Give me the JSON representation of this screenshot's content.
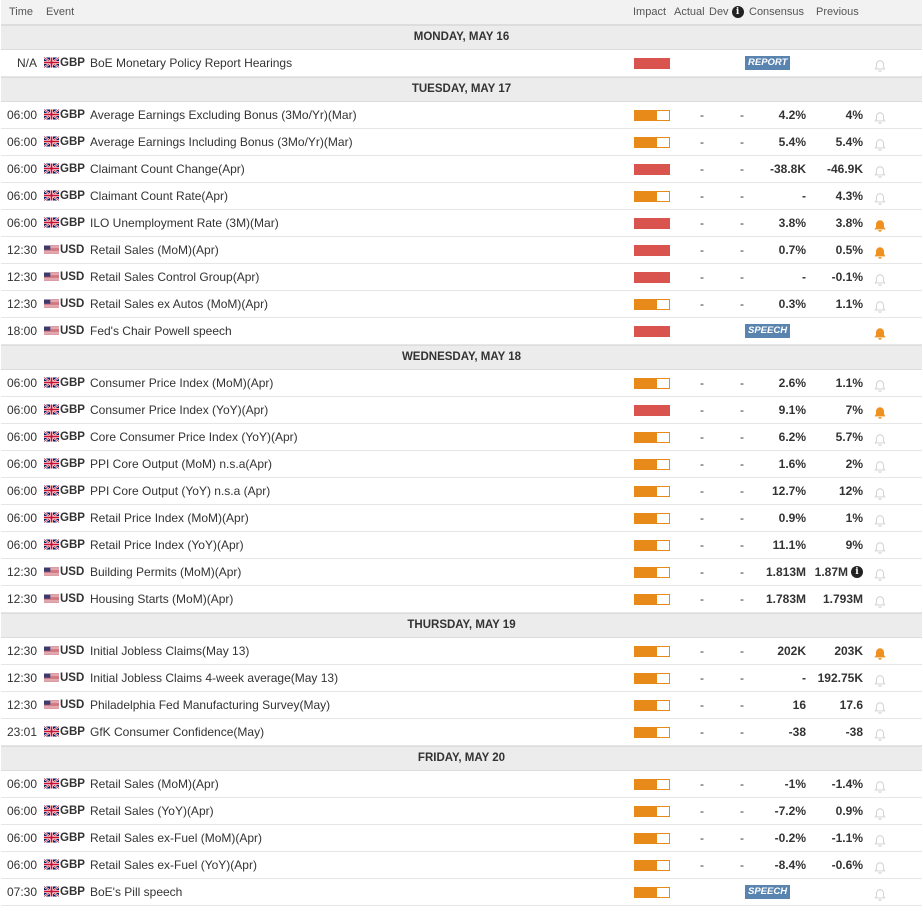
{
  "header": {
    "time": "Time",
    "event": "Event",
    "impact": "Impact",
    "actual": "Actual",
    "dev": "Dev",
    "consensus": "Consensus",
    "previous": "Previous"
  },
  "colors": {
    "high": "#d9534f",
    "medium": "#e88a1a",
    "bell_active": "#f0901e",
    "bell_inactive": "#cfcfcf",
    "tag": "#5a84b0"
  },
  "days": [
    {
      "label": "MONDAY, MAY 16",
      "rows": [
        {
          "time": "N/A",
          "cur": "GBP",
          "event": "BoE Monetary Policy Report Hearings",
          "impact": "high",
          "tag": "REPORT",
          "actual": "",
          "dev": "",
          "cons": "",
          "prev": "",
          "bell": false
        }
      ]
    },
    {
      "label": "TUESDAY, MAY 17",
      "rows": [
        {
          "time": "06:00",
          "cur": "GBP",
          "event": "Average Earnings Excluding Bonus (3Mo/Yr)(Mar)",
          "impact": "medium",
          "actual": "-",
          "dev": "-",
          "cons": "4.2%",
          "prev": "4%",
          "bell": false
        },
        {
          "time": "06:00",
          "cur": "GBP",
          "event": "Average Earnings Including Bonus (3Mo/Yr)(Mar)",
          "impact": "medium",
          "actual": "-",
          "dev": "-",
          "cons": "5.4%",
          "prev": "5.4%",
          "bell": false
        },
        {
          "time": "06:00",
          "cur": "GBP",
          "event": "Claimant Count Change(Apr)",
          "impact": "high",
          "actual": "-",
          "dev": "-",
          "cons": "-38.8K",
          "prev": "-46.9K",
          "bell": false
        },
        {
          "time": "06:00",
          "cur": "GBP",
          "event": "Claimant Count Rate(Apr)",
          "impact": "medium",
          "actual": "-",
          "dev": "-",
          "cons": "-",
          "prev": "4.3%",
          "bell": false
        },
        {
          "time": "06:00",
          "cur": "GBP",
          "event": "ILO Unemployment Rate (3M)(Mar)",
          "impact": "high",
          "actual": "-",
          "dev": "-",
          "cons": "3.8%",
          "prev": "3.8%",
          "bell": true
        },
        {
          "time": "12:30",
          "cur": "USD",
          "event": "Retail Sales (MoM)(Apr)",
          "impact": "high",
          "actual": "-",
          "dev": "-",
          "cons": "0.7%",
          "prev": "0.5%",
          "bell": true
        },
        {
          "time": "12:30",
          "cur": "USD",
          "event": "Retail Sales Control Group(Apr)",
          "impact": "high",
          "actual": "-",
          "dev": "-",
          "cons": "-",
          "prev": "-0.1%",
          "bell": false
        },
        {
          "time": "12:30",
          "cur": "USD",
          "event": "Retail Sales ex Autos (MoM)(Apr)",
          "impact": "medium",
          "actual": "-",
          "dev": "-",
          "cons": "0.3%",
          "prev": "1.1%",
          "bell": false
        },
        {
          "time": "18:00",
          "cur": "USD",
          "event": "Fed's Chair Powell speech",
          "impact": "high",
          "tag": "SPEECH",
          "actual": "",
          "dev": "",
          "cons": "",
          "prev": "",
          "bell": true
        }
      ]
    },
    {
      "label": "WEDNESDAY, MAY 18",
      "rows": [
        {
          "time": "06:00",
          "cur": "GBP",
          "event": "Consumer Price Index (MoM)(Apr)",
          "impact": "medium",
          "actual": "-",
          "dev": "-",
          "cons": "2.6%",
          "prev": "1.1%",
          "bell": false
        },
        {
          "time": "06:00",
          "cur": "GBP",
          "event": "Consumer Price Index (YoY)(Apr)",
          "impact": "high",
          "actual": "-",
          "dev": "-",
          "cons": "9.1%",
          "prev": "7%",
          "bell": true
        },
        {
          "time": "06:00",
          "cur": "GBP",
          "event": "Core Consumer Price Index (YoY)(Apr)",
          "impact": "medium",
          "actual": "-",
          "dev": "-",
          "cons": "6.2%",
          "prev": "5.7%",
          "bell": false
        },
        {
          "time": "06:00",
          "cur": "GBP",
          "event": "PPI Core Output (MoM) n.s.a(Apr)",
          "impact": "medium",
          "actual": "-",
          "dev": "-",
          "cons": "1.6%",
          "prev": "2%",
          "bell": false
        },
        {
          "time": "06:00",
          "cur": "GBP",
          "event": "PPI Core Output (YoY) n.s.a (Apr)",
          "impact": "medium",
          "actual": "-",
          "dev": "-",
          "cons": "12.7%",
          "prev": "12%",
          "bell": false
        },
        {
          "time": "06:00",
          "cur": "GBP",
          "event": "Retail Price Index (MoM)(Apr)",
          "impact": "medium",
          "actual": "-",
          "dev": "-",
          "cons": "0.9%",
          "prev": "1%",
          "bell": false
        },
        {
          "time": "06:00",
          "cur": "GBP",
          "event": "Retail Price Index (YoY)(Apr)",
          "impact": "medium",
          "actual": "-",
          "dev": "-",
          "cons": "11.1%",
          "prev": "9%",
          "bell": false
        },
        {
          "time": "12:30",
          "cur": "USD",
          "event": "Building Permits (MoM)(Apr)",
          "impact": "medium",
          "actual": "-",
          "dev": "-",
          "cons": "1.813M",
          "prev": "1.87M",
          "prev_info": true,
          "bell": false
        },
        {
          "time": "12:30",
          "cur": "USD",
          "event": "Housing Starts (MoM)(Apr)",
          "impact": "medium",
          "actual": "-",
          "dev": "-",
          "cons": "1.783M",
          "prev": "1.793M",
          "bell": false
        }
      ]
    },
    {
      "label": "THURSDAY, MAY 19",
      "rows": [
        {
          "time": "12:30",
          "cur": "USD",
          "event": "Initial Jobless Claims(May 13)",
          "impact": "medium",
          "actual": "-",
          "dev": "-",
          "cons": "202K",
          "prev": "203K",
          "bell": true
        },
        {
          "time": "12:30",
          "cur": "USD",
          "event": "Initial Jobless Claims 4-week average(May 13)",
          "impact": "medium",
          "actual": "-",
          "dev": "-",
          "cons": "-",
          "prev": "192.75K",
          "bell": false
        },
        {
          "time": "12:30",
          "cur": "USD",
          "event": "Philadelphia Fed Manufacturing Survey(May)",
          "impact": "medium",
          "actual": "-",
          "dev": "-",
          "cons": "16",
          "prev": "17.6",
          "bell": false
        },
        {
          "time": "23:01",
          "cur": "GBP",
          "event": "GfK Consumer Confidence(May)",
          "impact": "medium",
          "actual": "-",
          "dev": "-",
          "cons": "-38",
          "prev": "-38",
          "bell": false
        }
      ]
    },
    {
      "label": "FRIDAY, MAY 20",
      "rows": [
        {
          "time": "06:00",
          "cur": "GBP",
          "event": "Retail Sales (MoM)(Apr)",
          "impact": "medium",
          "actual": "-",
          "dev": "-",
          "cons": "-1%",
          "prev": "-1.4%",
          "bell": false
        },
        {
          "time": "06:00",
          "cur": "GBP",
          "event": "Retail Sales (YoY)(Apr)",
          "impact": "medium",
          "actual": "-",
          "dev": "-",
          "cons": "-7.2%",
          "prev": "0.9%",
          "bell": false
        },
        {
          "time": "06:00",
          "cur": "GBP",
          "event": "Retail Sales ex-Fuel (MoM)(Apr)",
          "impact": "medium",
          "actual": "-",
          "dev": "-",
          "cons": "-0.2%",
          "prev": "-1.1%",
          "bell": false
        },
        {
          "time": "06:00",
          "cur": "GBP",
          "event": "Retail Sales ex-Fuel (YoY)(Apr)",
          "impact": "medium",
          "actual": "-",
          "dev": "-",
          "cons": "-8.4%",
          "prev": "-0.6%",
          "bell": false
        },
        {
          "time": "07:30",
          "cur": "GBP",
          "event": "BoE's Pill speech",
          "impact": "medium",
          "tag": "SPEECH",
          "actual": "",
          "dev": "",
          "cons": "",
          "prev": "",
          "bell": false
        }
      ]
    }
  ]
}
